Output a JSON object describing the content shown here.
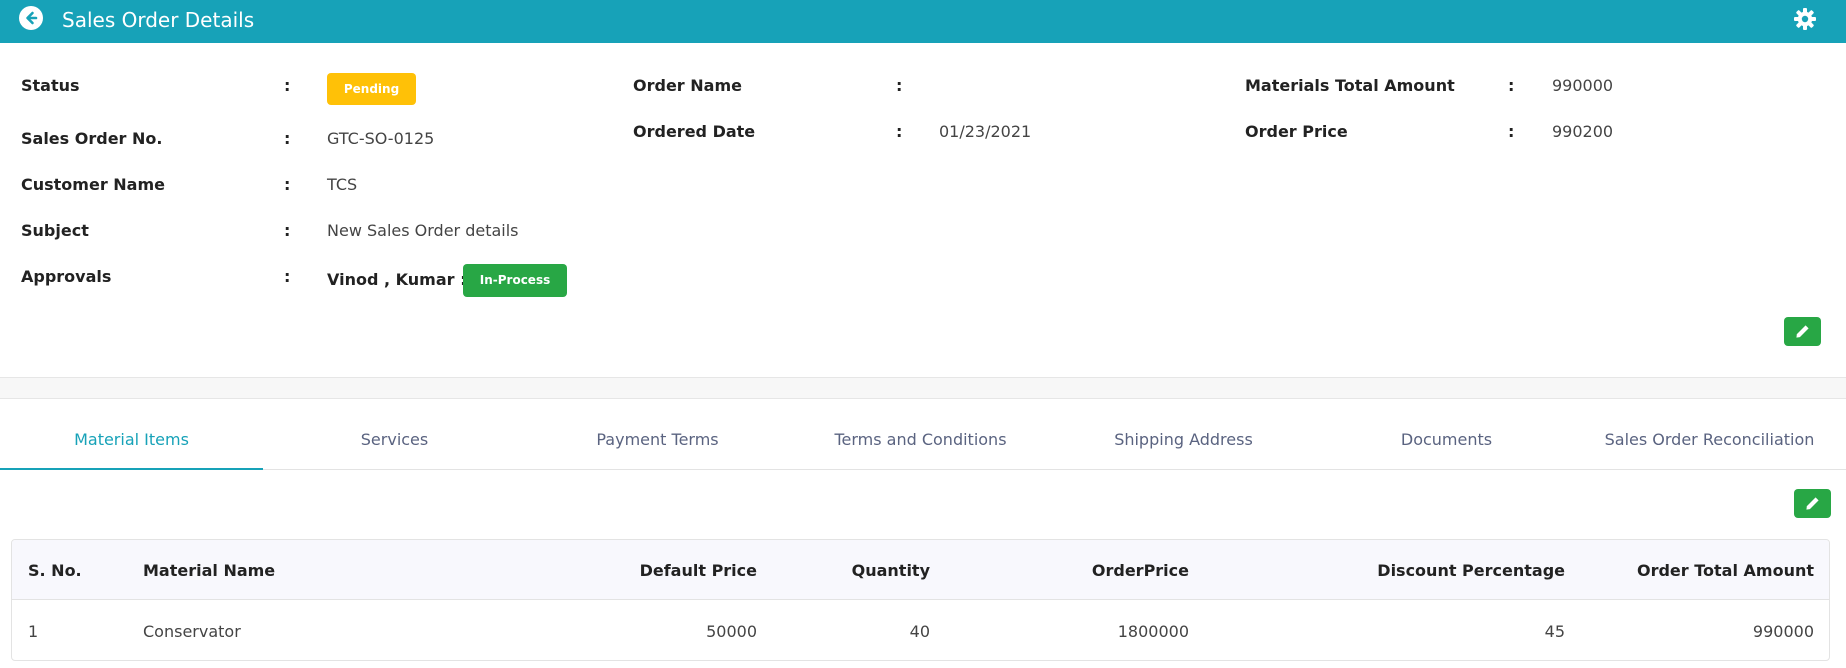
{
  "header": {
    "title": "Sales Order Details",
    "back_icon": "arrow-left-circle-icon",
    "settings_icon": "gear-icon",
    "background": "#17a2b8"
  },
  "details": {
    "status_label": "Status",
    "status_value": "Pending",
    "sales_order_no_label": "Sales Order No.",
    "sales_order_no_value": "GTC-SO-0125",
    "customer_name_label": "Customer Name",
    "customer_name_value": "TCS",
    "subject_label": "Subject",
    "subject_value": "New Sales Order details",
    "approvals_label": "Approvals",
    "approvals_value": "Vinod , Kumar :",
    "approvals_status": "In-Process",
    "order_name_label": "Order Name",
    "order_name_value": "",
    "ordered_date_label": "Ordered Date",
    "ordered_date_value": "01/23/2021",
    "materials_total_label": "Materials Total Amount",
    "materials_total_value": "990000",
    "order_price_label": "Order Price",
    "order_price_value": "990200",
    "colon": ":"
  },
  "tabs": [
    {
      "label": "Material Items",
      "active": true
    },
    {
      "label": "Services",
      "active": false
    },
    {
      "label": "Payment Terms",
      "active": false
    },
    {
      "label": "Terms and Conditions",
      "active": false
    },
    {
      "label": "Shipping Address",
      "active": false
    },
    {
      "label": "Documents",
      "active": false
    },
    {
      "label": "Sales Order Reconciliation",
      "active": false
    }
  ],
  "table": {
    "columns": [
      "S. No.",
      "Material Name",
      "Default Price",
      "Quantity",
      "OrderPrice",
      "Discount Percentage",
      "Order Total Amount"
    ],
    "rows": [
      [
        "1",
        "Conservator",
        "50000",
        "40",
        "1800000",
        "45",
        "990000"
      ]
    ]
  },
  "colors": {
    "accent": "#17a2b8",
    "pending": "#ffc107",
    "success": "#28a745"
  }
}
